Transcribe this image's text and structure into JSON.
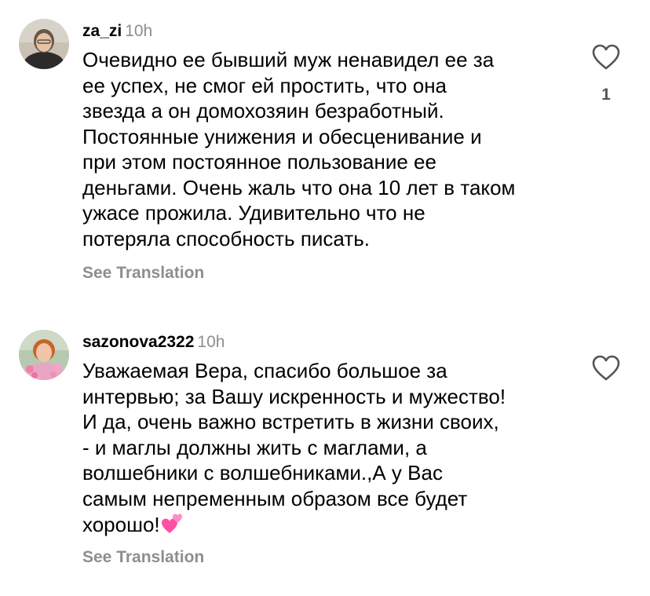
{
  "comments": [
    {
      "username": "za_zi",
      "time": "10h",
      "text": "Очевидно ее бывший муж ненавидел ее за\nее успех, не смог ей простить, что она\nзвезда а он домохозяин безработный.\nПостоянные унижения и обесценивание и\nпри этом постоянное пользование ее\nденьгами. Очень жаль что она 10 лет в таком\nужасе прожила. Удивительно что не\nпотеряла способность писать.",
      "see_translation": "See Translation",
      "like_count": "1",
      "icons": {
        "like": "heart-outline-icon",
        "avatar": "user-avatar"
      }
    },
    {
      "username": "sazonova2322",
      "time": "10h",
      "text": "Уважаемая Вера, спасибо большое за\nинтервью; за Вашу искренность и мужество!\nИ да, очень важно встретить в жизни своих,\n- и маглы должны жить с маглами, а\nволшебники с волшебниками.,А у Вас\nсамым непременным образом все будет\nхорошо!",
      "emoji": "two-hearts-emoji",
      "see_translation": "See Translation",
      "icons": {
        "like": "heart-outline-icon",
        "avatar": "user-avatar"
      }
    }
  ],
  "colors": {
    "text": "#000000",
    "secondary": "#8e8e8e",
    "emoji_pink": "#ff4fa3"
  }
}
